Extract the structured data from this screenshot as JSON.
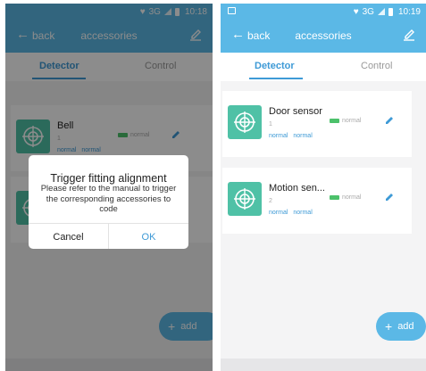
{
  "left_screen": {
    "status_bar": {
      "network": "3G",
      "time": "10:18"
    },
    "title_bar": {
      "back_label": "back",
      "title": "accessories"
    },
    "tabs": [
      {
        "label": "Detector",
        "active": true
      },
      {
        "label": "Control",
        "active": false
      }
    ],
    "cards": [
      {
        "name": "Bell",
        "number": "1",
        "tags": [
          "normal",
          "normal"
        ],
        "status": "normal"
      }
    ],
    "add_label": "add",
    "dialog": {
      "title": "Trigger fitting alignment",
      "message": "Please refer to the manual to trigger the corresponding accessories to code",
      "cancel_label": "Cancel",
      "ok_label": "OK"
    }
  },
  "right_screen": {
    "status_bar": {
      "network": "3G",
      "time": "10:19"
    },
    "title_bar": {
      "back_label": "back",
      "title": "accessories"
    },
    "tabs": [
      {
        "label": "Detector",
        "active": true
      },
      {
        "label": "Control",
        "active": false
      }
    ],
    "cards": [
      {
        "name": "Door sensor",
        "number": "1",
        "tags": [
          "normal",
          "normal"
        ],
        "status": "normal"
      },
      {
        "name": "Motion sen...",
        "number": "2",
        "tags": [
          "normal",
          "normal"
        ],
        "status": "normal"
      }
    ],
    "add_label": "add"
  },
  "colors": {
    "primary": "#5bb8e6",
    "accent_text": "#3e9ad6",
    "device_icon": "#4fc1a6",
    "battery": "#4cc16b"
  },
  "icons": [
    "back-arrow-icon",
    "edit-icon",
    "target-icon",
    "battery-icon",
    "pencil-icon",
    "plus-icon",
    "heart-icon",
    "signal-icon"
  ]
}
